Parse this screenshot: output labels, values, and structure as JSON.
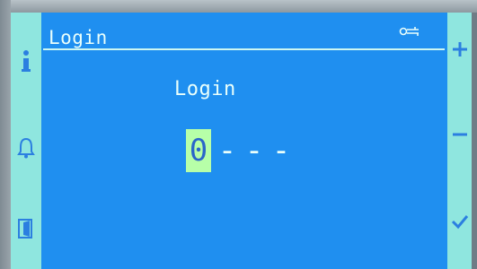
{
  "header": {
    "title": "Login"
  },
  "main": {
    "login_label": "Login",
    "pin_digits": [
      "0",
      "-",
      "-",
      "-"
    ],
    "active_digit_index": 0
  },
  "colors": {
    "screen_background": "#1f8ff0",
    "side_strip": "#8fe6df",
    "text": "#e9fffb",
    "active_digit_background": "#b7ffa8",
    "active_digit_text": "#2a66c9"
  },
  "icons": {
    "left_strip": [
      "info-icon",
      "bell-icon",
      "door-exit-icon"
    ],
    "right_strip": [
      "plus-icon",
      "minus-icon",
      "check-icon"
    ],
    "header": "key-icon"
  }
}
